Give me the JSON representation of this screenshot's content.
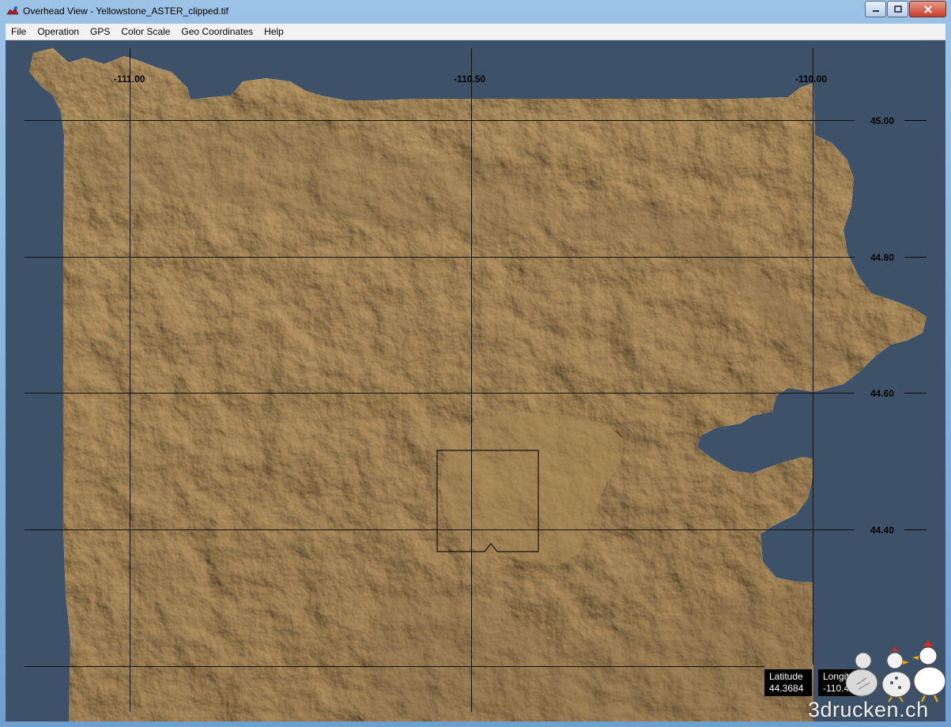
{
  "window": {
    "title": "Overhead View - Yellowstone_ASTER_clipped.tif",
    "controls": {
      "minimize": "—",
      "maximize": "□",
      "close": "✕"
    }
  },
  "menu": {
    "items": [
      "File",
      "Operation",
      "GPS",
      "Color Scale",
      "Geo Coordinates",
      "Help"
    ]
  },
  "map": {
    "longitude_labels": [
      "-111.00",
      "-110.50",
      "-110.00"
    ],
    "latitude_labels": [
      "45.00",
      "44.80",
      "44.60",
      "44.40"
    ],
    "background_color": "#3d5268",
    "terrain_color": "#b08f60"
  },
  "readout": {
    "latitude_label": "Latitude",
    "latitude_value": "44.3684",
    "longitude_label": "Longit",
    "longitude_value": "-110.4"
  },
  "watermark": {
    "text": "3drucken.ch"
  },
  "icons": {
    "app": "dem-viewer-icon",
    "mascots": "chicken-mascots-logo"
  }
}
